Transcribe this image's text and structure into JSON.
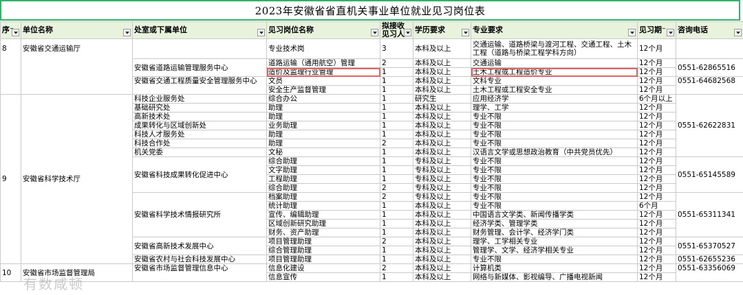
{
  "title": "2023年安徽省省直机关事业单位就业见习岗位表",
  "headers": [
    "序号",
    "单位名称",
    "处室或下属单位",
    "见习岗位名称",
    "拟接收见习人数",
    "学历要求",
    "专业要求",
    "见习期限",
    "咨询电话"
  ],
  "header_display": {
    "seq": "序⁻",
    "unit": "单位名称",
    "dept": "处室或下属单位",
    "post": "见习岗位名称",
    "count_1": "拟接收",
    "count_2": "见习人",
    "edu": "学历要求",
    "major": "专业要求",
    "period": "见习期⁻",
    "phone": "咨询电话"
  },
  "groups": {
    "g8": {
      "seq": "8",
      "unit": "安徽省交通运输厅"
    },
    "g9": {
      "seq": "9",
      "unit": "安徽省科学技术厅"
    },
    "g10": {
      "seq": "10",
      "unit": "安徽省市场监督管理局"
    }
  },
  "depts": {
    "road": "安徽省道路运输管理服务中心",
    "quality": "安徽省交通工程质量安全管理服务中心",
    "kjqy": "科技企业服务处",
    "jcyj": "基础研究处",
    "gxjs": "高新技术处",
    "cgzh": "成果转化与区域创新处",
    "kjrc": "科技人才服务处",
    "kjhz": "科技合作处",
    "jgdw": "机关党委",
    "cgzx": "安徽省科技成果转化促进中心",
    "qbyj": "安徽省科学技术情报研究所",
    "gxfz": "安徽省高新技术发展中心",
    "ncsh": "安徽省农村与社会科技发展中心",
    "xxzx": "安徽省市场监督管理信息中心"
  },
  "phones": {
    "road": "0551-62865516",
    "quality": "0551-64682568",
    "kjt": "0551-62622831",
    "cgzx": "0551-65145589",
    "qbyj": "0551-65311341",
    "gxfz": "0551-65370527",
    "ncsh": "0551-62655236",
    "xxzx": "0551-63356069"
  },
  "rows": [
    {
      "post": "专业技术岗",
      "count": "3",
      "edu": "本科及以上",
      "major": "交通运输、道路桥梁与渡河工程、交通工程、土木工程（道路与桥梁工程学科方向）",
      "period": "12个月"
    },
    {
      "post": "道路运输（通用航空）管理",
      "count": "2",
      "edu": "本科及以上",
      "major": "交通运输",
      "period": "12个月"
    },
    {
      "post": "造价及监理行业管理",
      "count": "1",
      "edu": "本科及以上",
      "major": "土木工程或工程造价专业",
      "period": "12个月"
    },
    {
      "post": "文员",
      "count": "1",
      "edu": "本科及以上",
      "major": "文科专业",
      "period": "12个月"
    },
    {
      "post": "安全生产监督管理",
      "count": "1",
      "edu": "本科及以上",
      "major": "土木工程或工程安全专业",
      "period": "12个月"
    },
    {
      "post": "综合办公",
      "count": "1",
      "edu": "研究生",
      "major": "应用经济学",
      "period": "6个月以上"
    },
    {
      "post": "助理",
      "count": "1",
      "edu": "本科及以上",
      "major": "理学、工学",
      "period": "12个月"
    },
    {
      "post": "助理",
      "count": "1",
      "edu": "本科及以上",
      "major": "专业不限",
      "period": "12个月"
    },
    {
      "post": "业务助理",
      "count": "1",
      "edu": "本科及以上",
      "major": "专业不限",
      "period": "12个月"
    },
    {
      "post": "助理",
      "count": "1",
      "edu": "本科及以上",
      "major": "专业不限",
      "period": "12个月"
    },
    {
      "post": "助理",
      "count": "2",
      "edu": "本科及以上",
      "major": "专业不限",
      "period": "12个月"
    },
    {
      "post": "文秘",
      "count": "1",
      "edu": "本科及以上",
      "major": "汉语言文学或思想政治教育（中共党员优先）",
      "period": "12个月"
    },
    {
      "post": "综合助理",
      "count": "1",
      "edu": "专科及以上",
      "major": "专业不限",
      "period": "12个月"
    },
    {
      "post": "文字助理",
      "count": "1",
      "edu": "专科及以上",
      "major": "专业不限",
      "period": "12个月"
    },
    {
      "post": "工程助理",
      "count": "1",
      "edu": "专科及以上",
      "major": "专业不限",
      "period": "12个月"
    },
    {
      "post": "综合助理",
      "count": "2",
      "edu": "专科及以上",
      "major": "专业不限",
      "period": "12个月"
    },
    {
      "post": "档案助理",
      "count": "2",
      "edu": "专科及以上",
      "major": "专业不限",
      "period": "12个月"
    },
    {
      "post": "统计助理",
      "count": "1",
      "edu": "本科及以上",
      "major": "专业不限",
      "period": "6个月"
    },
    {
      "post": "宣传、编辑助理",
      "count": "1",
      "edu": "本科及以上",
      "major": "中国语言文学类、新闻传播学类",
      "period": "12个月"
    },
    {
      "post": "区域创新研究助理",
      "count": "1",
      "edu": "本科及以上",
      "major": "经济学类、管理学类",
      "period": "12个月"
    },
    {
      "post": "财务、资产助理",
      "count": "1",
      "edu": "本科及以上",
      "major": "财务管理、会计学、经济学门类",
      "period": "12个月"
    },
    {
      "post": "项目管理助理",
      "count": "2",
      "edu": "本科及以上",
      "major": "理学、工学相关专业",
      "period": "12个月"
    },
    {
      "post": "综合管理助理",
      "count": "1",
      "edu": "本科及以上",
      "major": "管理学、文学、经济学相关专业",
      "period": "12个月"
    },
    {
      "post": "项目管理助理",
      "count": "1",
      "edu": "本科及以上",
      "major": "专业不限",
      "period": "12个月"
    },
    {
      "post": "信息化建设",
      "count": "2",
      "edu": "本科及以上",
      "major": "计算机类",
      "period": "12个月"
    },
    {
      "post": "信息宣传",
      "count": "1",
      "edu": "本科及以上",
      "major": "网络与新媒体、影视编导、广播电视新闻",
      "period": "12个月"
    }
  ],
  "watermark": "有数咸顿",
  "highlight_color": "#e06464",
  "header_bg": "#e8f2dc",
  "title_border_color": "#2fb36b"
}
